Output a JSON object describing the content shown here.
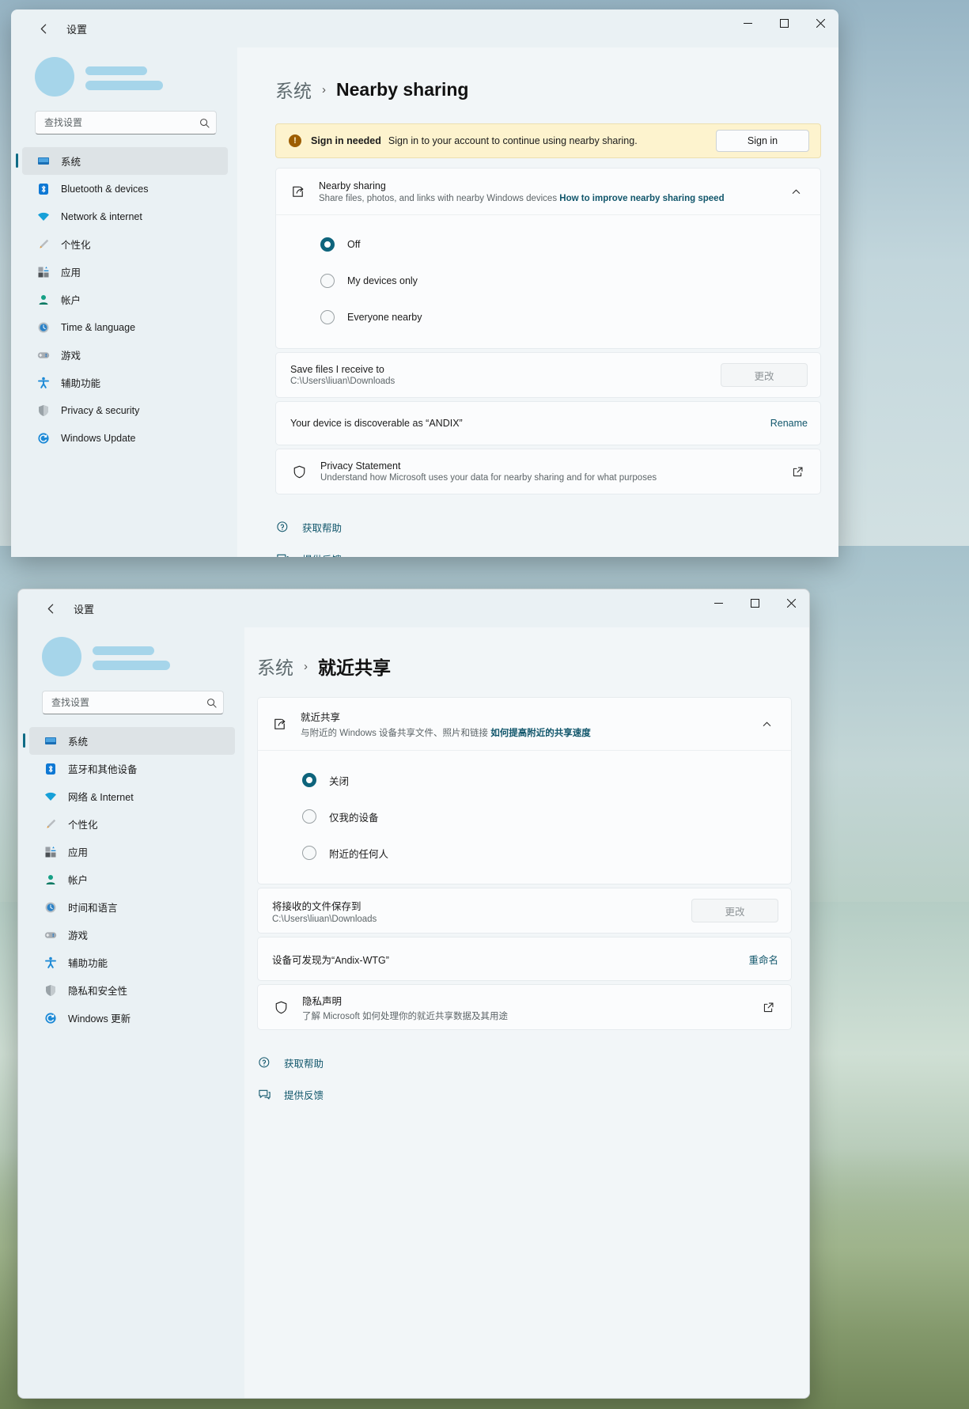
{
  "window_top": {
    "titlebar": {
      "back_icon": "back-arrow-icon",
      "title": "设置",
      "minimize": "—",
      "maximize": "▢",
      "close": "✕"
    },
    "sidebar": {
      "search": {
        "placeholder": "查找设置",
        "icon": "search-icon"
      },
      "items": [
        {
          "label": "系统",
          "icon": "system-icon",
          "active": true
        },
        {
          "label": "Bluetooth & devices",
          "icon": "bluetooth-icon",
          "active": false
        },
        {
          "label": "Network & internet",
          "icon": "network-icon",
          "active": false
        },
        {
          "label": "个性化",
          "icon": "personalization-icon",
          "active": false
        },
        {
          "label": "应用",
          "icon": "apps-icon",
          "active": false
        },
        {
          "label": "帐户",
          "icon": "accounts-icon",
          "active": false
        },
        {
          "label": "Time & language",
          "icon": "time-language-icon",
          "active": false
        },
        {
          "label": "游戏",
          "icon": "gaming-icon",
          "active": false
        },
        {
          "label": "辅助功能",
          "icon": "accessibility-icon",
          "active": false
        },
        {
          "label": "Privacy & security",
          "icon": "privacy-shield-icon",
          "active": false
        },
        {
          "label": "Windows Update",
          "icon": "windows-update-icon",
          "active": false
        }
      ]
    },
    "breadcrumb": {
      "root": "系统",
      "separator": "›",
      "leaf": "Nearby sharing"
    },
    "banner": {
      "icon": "warning-icon",
      "title": "Sign in needed",
      "text": "Sign in to your account to continue using nearby sharing.",
      "button": "Sign in"
    },
    "nearby_card": {
      "icon": "share-icon",
      "title": "Nearby sharing",
      "subtitle": "Share files, photos, and links with nearby Windows devices",
      "link": "How to improve nearby sharing speed",
      "chevron": "chevron-up-icon"
    },
    "radios": [
      {
        "label": "Off",
        "selected": true
      },
      {
        "label": "My devices only",
        "selected": false
      },
      {
        "label": "Everyone nearby",
        "selected": false
      }
    ],
    "save_row": {
      "title": "Save files I receive to",
      "path": "C:\\Users\\liuan\\Downloads",
      "button": "更改"
    },
    "device_row": {
      "text": "Your device is discoverable as “ANDIX”",
      "action": "Rename"
    },
    "privacy_row": {
      "icon": "shield-icon",
      "title": "Privacy Statement",
      "subtitle": "Understand how Microsoft uses your data for nearby sharing and for what purposes",
      "external_icon": "external-link-icon"
    },
    "footer": [
      {
        "label": "获取帮助",
        "icon": "help-icon"
      },
      {
        "label": "提供反馈",
        "icon": "feedback-icon"
      }
    ]
  },
  "window_bottom": {
    "titlebar": {
      "back_icon": "back-arrow-icon",
      "title": "设置",
      "minimize": "—",
      "maximize": "▢",
      "close": "✕"
    },
    "sidebar": {
      "search": {
        "placeholder": "查找设置",
        "icon": "search-icon"
      },
      "items": [
        {
          "label": "系统",
          "icon": "system-icon",
          "active": true
        },
        {
          "label": "蓝牙和其他设备",
          "icon": "bluetooth-icon",
          "active": false
        },
        {
          "label": "网络 & Internet",
          "icon": "network-icon",
          "active": false
        },
        {
          "label": "个性化",
          "icon": "personalization-icon",
          "active": false
        },
        {
          "label": "应用",
          "icon": "apps-icon",
          "active": false
        },
        {
          "label": "帐户",
          "icon": "accounts-icon",
          "active": false
        },
        {
          "label": "时间和语言",
          "icon": "time-language-icon",
          "active": false
        },
        {
          "label": "游戏",
          "icon": "gaming-icon",
          "active": false
        },
        {
          "label": "辅助功能",
          "icon": "accessibility-icon",
          "active": false
        },
        {
          "label": "隐私和安全性",
          "icon": "privacy-shield-icon",
          "active": false
        },
        {
          "label": "Windows 更新",
          "icon": "windows-update-icon",
          "active": false
        }
      ]
    },
    "breadcrumb": {
      "root": "系统",
      "separator": "›",
      "leaf": "就近共享"
    },
    "nearby_card": {
      "icon": "share-icon",
      "title": "就近共享",
      "subtitle": "与附近的 Windows 设备共享文件、照片和链接",
      "link": "如何提高附近的共享速度",
      "chevron": "chevron-up-icon"
    },
    "radios": [
      {
        "label": "关闭",
        "selected": true
      },
      {
        "label": "仅我的设备",
        "selected": false
      },
      {
        "label": "附近的任何人",
        "selected": false
      }
    ],
    "save_row": {
      "title": "将接收的文件保存到",
      "path": "C:\\Users\\liuan\\Downloads",
      "button": "更改"
    },
    "device_row": {
      "text": "设备可发现为“Andix-WTG”",
      "action": "重命名"
    },
    "privacy_row": {
      "icon": "shield-icon",
      "title": "隐私声明",
      "subtitle": "了解 Microsoft 如何处理你的就近共享数据及其用途",
      "external_icon": "external-link-icon"
    },
    "footer": [
      {
        "label": "获取帮助",
        "icon": "help-icon"
      },
      {
        "label": "提供反馈",
        "icon": "feedback-icon"
      }
    ]
  },
  "colors": {
    "accent": "#0e647c",
    "link": "#11566b",
    "banner_bg": "#fdf3ce",
    "banner_icon": "#9d5d00",
    "avatar": "#a6d5ea",
    "card_bg": "#fbfcfd"
  }
}
